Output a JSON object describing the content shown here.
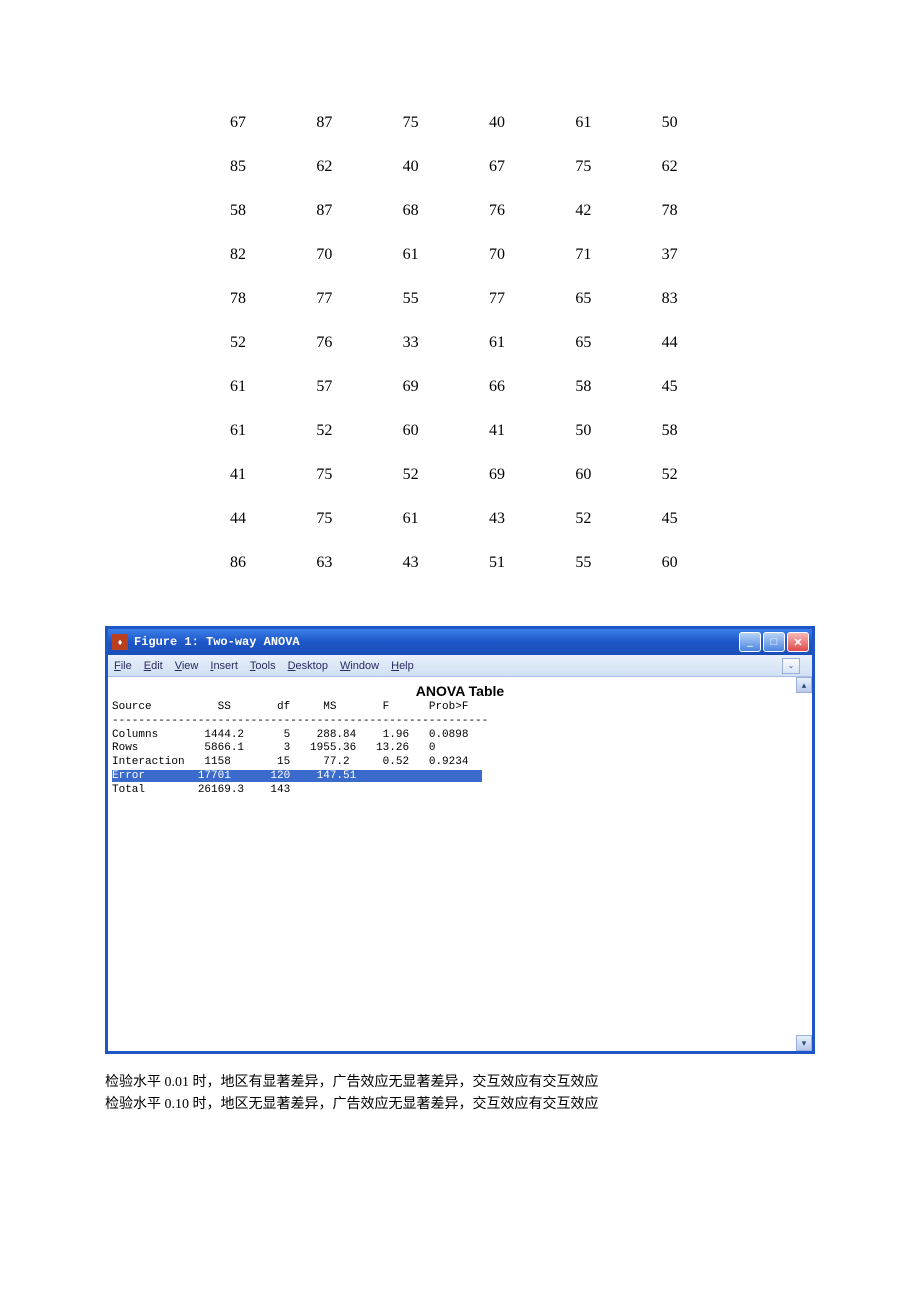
{
  "data_table": {
    "rows": [
      [
        "67",
        "87",
        "75",
        "40",
        "61",
        "50"
      ],
      [
        "85",
        "62",
        "40",
        "67",
        "75",
        "62"
      ],
      [
        "58",
        "87",
        "68",
        "76",
        "42",
        "78"
      ],
      [
        "82",
        "70",
        "61",
        "70",
        "71",
        "37"
      ],
      [
        "78",
        "77",
        "55",
        "77",
        "65",
        "83"
      ],
      [
        "52",
        "76",
        "33",
        "61",
        "65",
        "44"
      ],
      [
        "61",
        "57",
        "69",
        "66",
        "58",
        "45"
      ],
      [
        "61",
        "52",
        "60",
        "41",
        "50",
        "58"
      ],
      [
        "41",
        "75",
        "52",
        "69",
        "60",
        "52"
      ],
      [
        "44",
        "75",
        "61",
        "43",
        "52",
        "45"
      ],
      [
        "86",
        "63",
        "43",
        "51",
        "55",
        "60"
      ]
    ]
  },
  "window": {
    "icon_label": "♦",
    "title": "Figure 1: Two-way ANOVA",
    "menus": [
      "File",
      "Edit",
      "View",
      "Insert",
      "Tools",
      "Desktop",
      "Window",
      "Help"
    ],
    "menus_html": [
      "<u>F</u>ile",
      "<u>E</u>dit",
      "<u>V</u>iew",
      "<u>I</u>nsert",
      "<u>T</u>ools",
      "<u>D</u>esktop",
      "<u>W</u>indow",
      "<u>H</u>elp"
    ],
    "dropdown_glyph": "⌄"
  },
  "anova": {
    "title": "ANOVA Table",
    "header": "Source          SS       df     MS       F      Prob>F",
    "divider": "---------------------------------------------------------",
    "rows": [
      "Columns       1444.2      5    288.84    1.96   0.0898",
      "Rows          5866.1      3   1955.36   13.26   0",
      "Interaction   1158       15     77.2     0.52   0.9234"
    ],
    "selected_row": "Error        17701      120    147.51                   ",
    "last_row": "Total        26169.3    143"
  },
  "chart_data": {
    "type": "table",
    "title": "ANOVA Table",
    "columns": [
      "Source",
      "SS",
      "df",
      "MS",
      "F",
      "Prob>F"
    ],
    "rows": [
      {
        "Source": "Columns",
        "SS": 1444.2,
        "df": 5,
        "MS": 288.84,
        "F": 1.96,
        "Prob>F": 0.0898
      },
      {
        "Source": "Rows",
        "SS": 5866.1,
        "df": 3,
        "MS": 1955.36,
        "F": 13.26,
        "Prob>F": 0
      },
      {
        "Source": "Interaction",
        "SS": 1158,
        "df": 15,
        "MS": 77.2,
        "F": 0.52,
        "Prob>F": 0.9234
      },
      {
        "Source": "Error",
        "SS": 17701,
        "df": 120,
        "MS": 147.51,
        "F": null,
        "Prob>F": null
      },
      {
        "Source": "Total",
        "SS": 26169.3,
        "df": 143,
        "MS": null,
        "F": null,
        "Prob>F": null
      }
    ]
  },
  "footer": {
    "line1": "检验水平 0.01 时，地区有显著差异，广告效应无显著差异，交互效应有交互效应",
    "line2": "检验水平 0.10 时，地区无显著差异，广告效应无显著差异，交互效应有交互效应"
  }
}
